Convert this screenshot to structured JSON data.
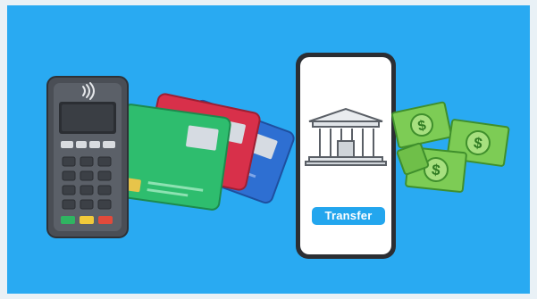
{
  "illustration": {
    "background_color": "#29aaf2",
    "frame_color": "#e9f1f6",
    "phone": {
      "button_label": "Transfer",
      "button_color": "#23a6ee",
      "icon": "bank-building-icon"
    },
    "terminal": {
      "icon": "contactless-icon",
      "body_color": "#4a4e55"
    },
    "cards": [
      {
        "name": "green-card",
        "color": "#2ebd6e"
      },
      {
        "name": "red-card",
        "color": "#d8304a"
      },
      {
        "name": "blue-card",
        "color": "#2e6fd2"
      }
    ],
    "cash": {
      "icon": "dollar-bill-icon",
      "count": 4,
      "color": "#7dcc55"
    }
  }
}
